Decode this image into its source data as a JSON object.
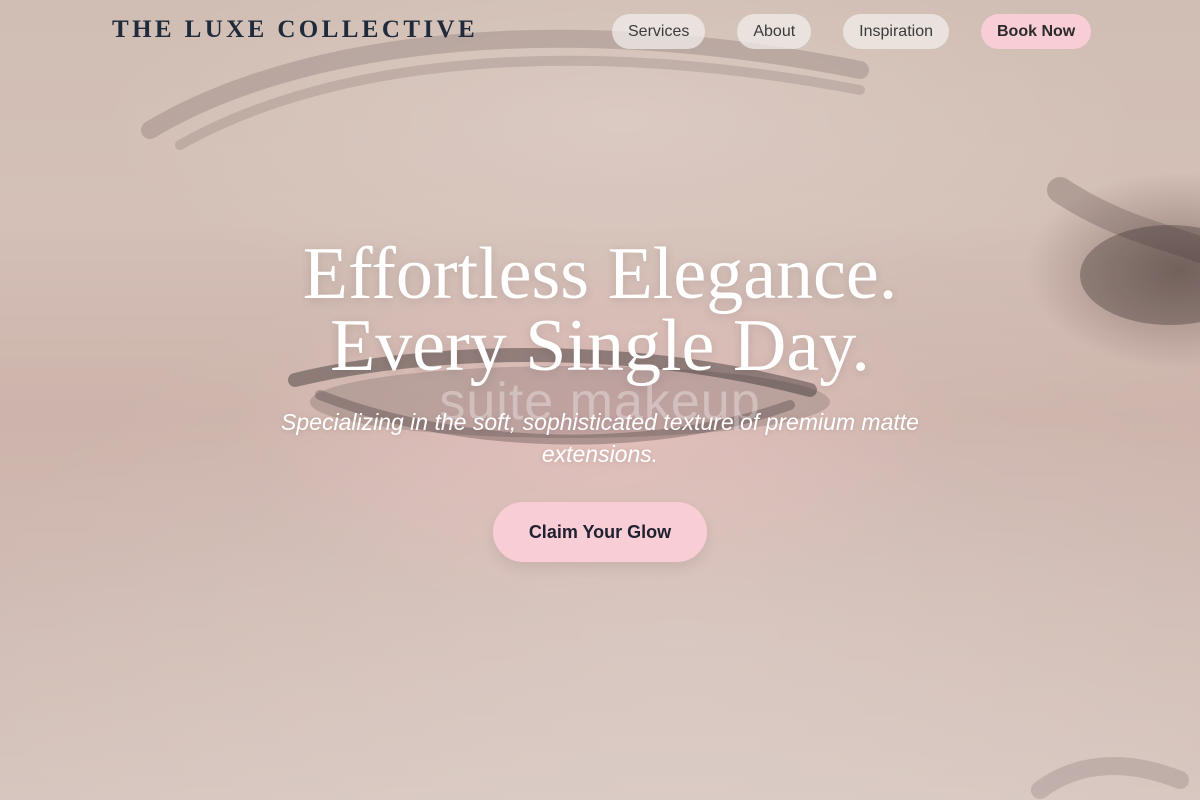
{
  "header": {
    "brand": "THE LUXE COLLECTIVE",
    "nav": [
      {
        "label": "Services"
      },
      {
        "label": "About"
      },
      {
        "label": "Inspiration"
      },
      {
        "label": "Book Now"
      }
    ]
  },
  "hero": {
    "title_line_1": "Effortless Elegance.",
    "title_line_2": "Every Single Day.",
    "ghost_text": "suite makeup",
    "subtitle": "Specializing in the soft, sophisticated texture of premium matte extensions.",
    "cta": "Claim Your Glow"
  },
  "colors": {
    "accent_pink": "#f8cdd6",
    "brand_navy": "#1f2a3a",
    "hero_text": "#ffffff"
  }
}
